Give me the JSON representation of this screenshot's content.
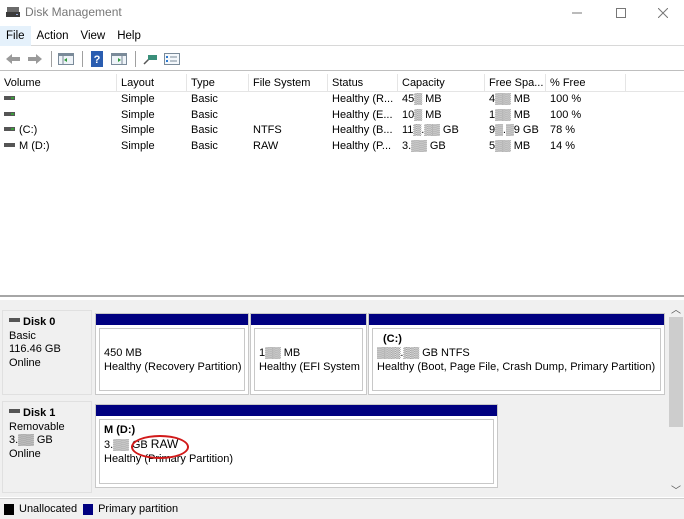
{
  "window": {
    "title": "Disk Management",
    "controls": {
      "minimize": "—",
      "maximize": "☐",
      "close": "✕"
    }
  },
  "menu": {
    "items": [
      "File",
      "Action",
      "View",
      "Help"
    ],
    "active": "File"
  },
  "toolbar": {
    "buttons": [
      "back-icon",
      "forward-icon",
      "show-hide-console-tree-icon",
      "help-icon",
      "show-action-pane-icon",
      "connect-icon",
      "properties-icon"
    ]
  },
  "volume_list": {
    "columns": [
      "Volume",
      "Layout",
      "Type",
      "File System",
      "Status",
      "Capacity",
      "Free Spa...",
      "% Free"
    ],
    "rows": [
      {
        "volume": "",
        "layout": "Simple",
        "type": "Basic",
        "file_system": "",
        "status": "Healthy (R...",
        "capacity": "45▒ MB",
        "free_space": "4▒▒ MB",
        "percent_free": "100 %"
      },
      {
        "volume": "",
        "layout": "Simple",
        "type": "Basic",
        "file_system": "",
        "status": "Healthy (E...",
        "capacity": "10▒ MB",
        "free_space": "1▒▒ MB",
        "percent_free": "100 %"
      },
      {
        "volume": "(C:)",
        "layout": "Simple",
        "type": "Basic",
        "file_system": "NTFS",
        "status": "Healthy (B...",
        "capacity": "11▒.▒▒ GB",
        "free_space": "9▒.▒9 GB",
        "percent_free": "78 %"
      },
      {
        "volume": "M (D:)",
        "layout": "Simple",
        "type": "Basic",
        "file_system": "RAW",
        "status": "Healthy (P...",
        "capacity": "3.▒▒ GB",
        "free_space": "5▒▒ MB",
        "percent_free": "14 %"
      }
    ]
  },
  "disks": [
    {
      "name": "Disk 0",
      "type": "Basic",
      "size": "116.46 GB",
      "status": "Online",
      "partitions": [
        {
          "name": "",
          "size": "450 MB",
          "status": "Healthy (Recovery Partition)"
        },
        {
          "name": "",
          "size": "1▒▒ MB",
          "status": "Healthy (EFI System P"
        },
        {
          "name": "(C:)",
          "size": "▒▒▒.▒▒ GB NTFS",
          "status": "Healthy (Boot, Page File, Crash Dump, Primary Partition)"
        }
      ]
    },
    {
      "name": "Disk 1",
      "type": "Removable",
      "size": "3.▒▒ GB",
      "status": "Online",
      "partitions": [
        {
          "name": "M  (D:)",
          "size_prefix": "3.▒▒ GB",
          "size_suffix": "RAW",
          "status": "Healthy (Primary Partition)"
        }
      ]
    }
  ],
  "legend": [
    {
      "label": "Unallocated",
      "color": "#000000"
    },
    {
      "label": "Primary partition",
      "color": "#000080"
    }
  ],
  "colors": {
    "partition_bar": "#000080",
    "annotation_circle": "#d21a1a"
  }
}
